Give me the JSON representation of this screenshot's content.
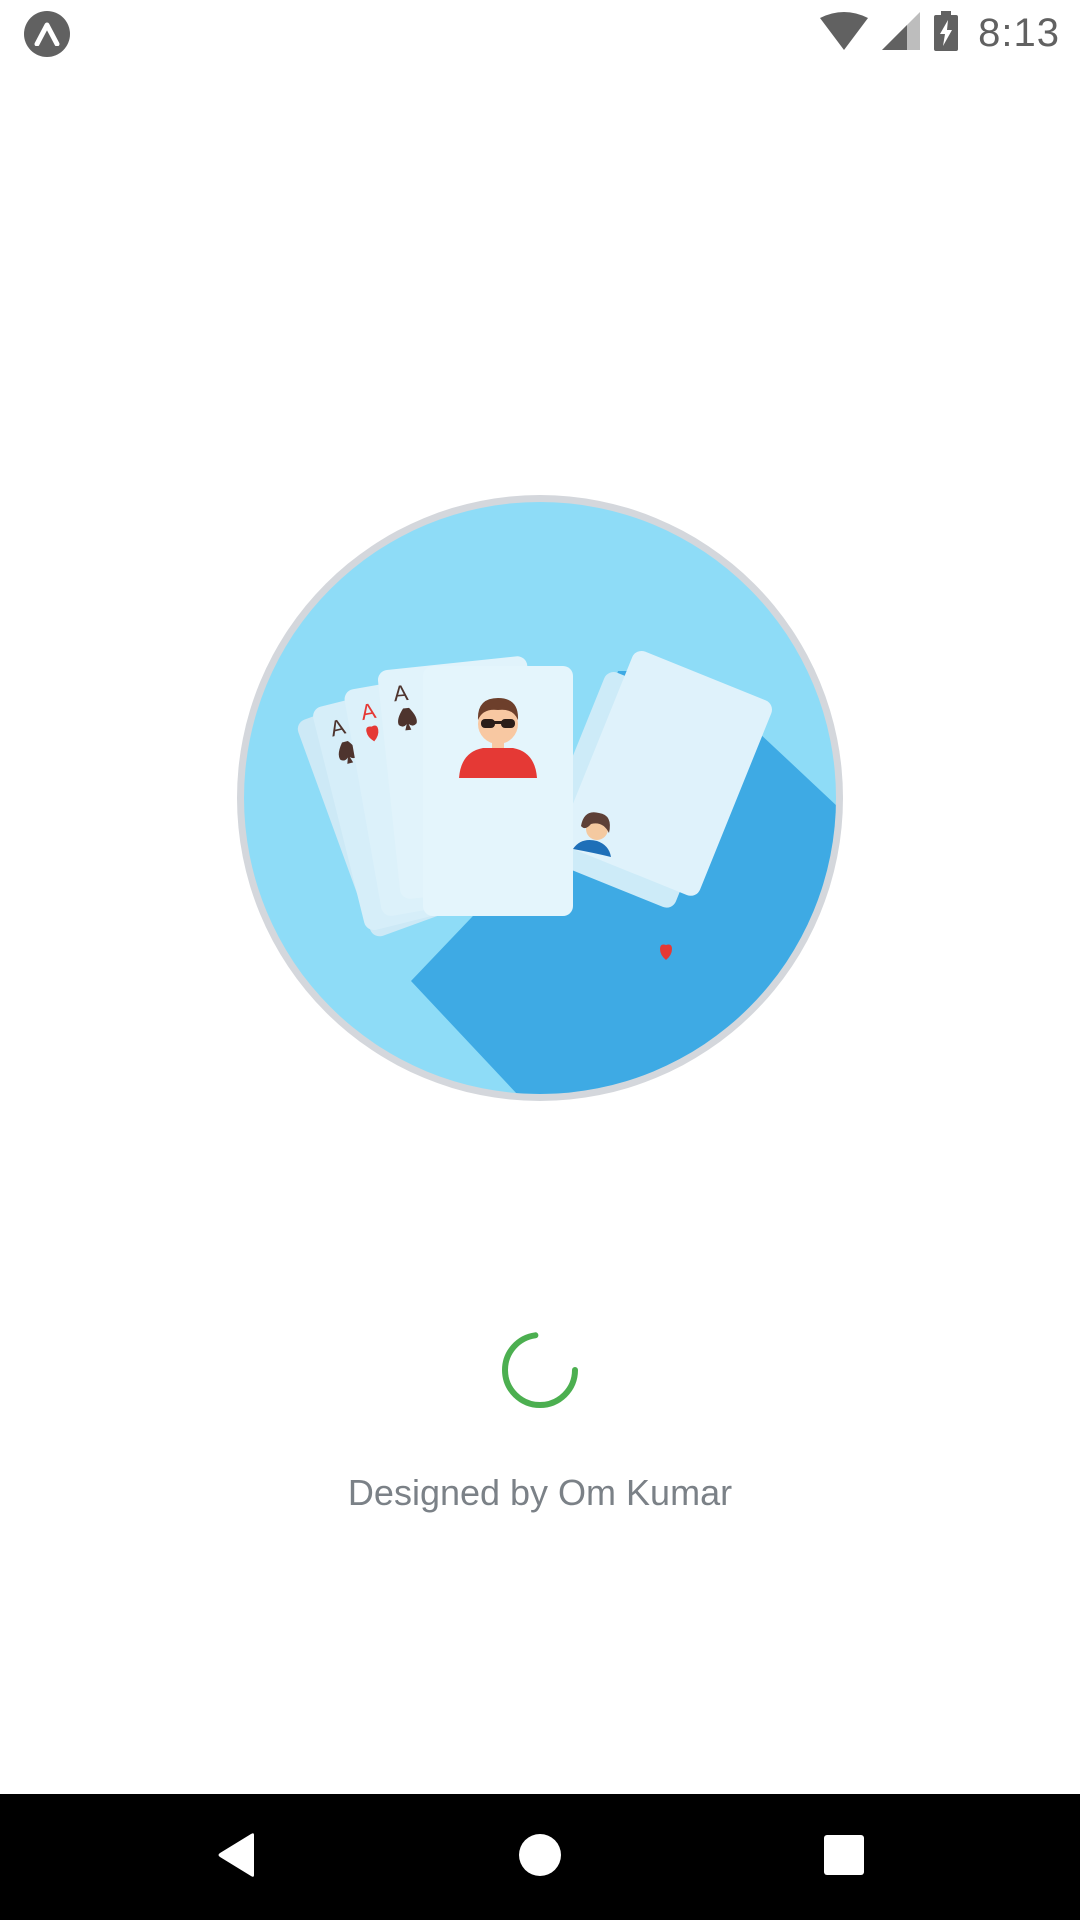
{
  "status_bar": {
    "app_icon": "expo-icon",
    "time": "8:13",
    "icons": [
      "wifi-icon",
      "cell-signal-icon",
      "battery-charging-icon"
    ]
  },
  "splash": {
    "logo": "playing-cards-illustration",
    "card_rank": "A",
    "credit_text": "Designed by Om Kumar"
  },
  "navigation": {
    "buttons": [
      "back-icon",
      "home-icon",
      "recents-icon"
    ]
  },
  "colors": {
    "circle_fill": "#8edcf7",
    "circle_border": "#d4d7dc",
    "shadow": "#3aa7e3",
    "card": "#e4f5fc",
    "spinner": "#4caf50",
    "credit_text": "#7b8187",
    "heart": "#e53935",
    "spade": "#4e342e"
  }
}
